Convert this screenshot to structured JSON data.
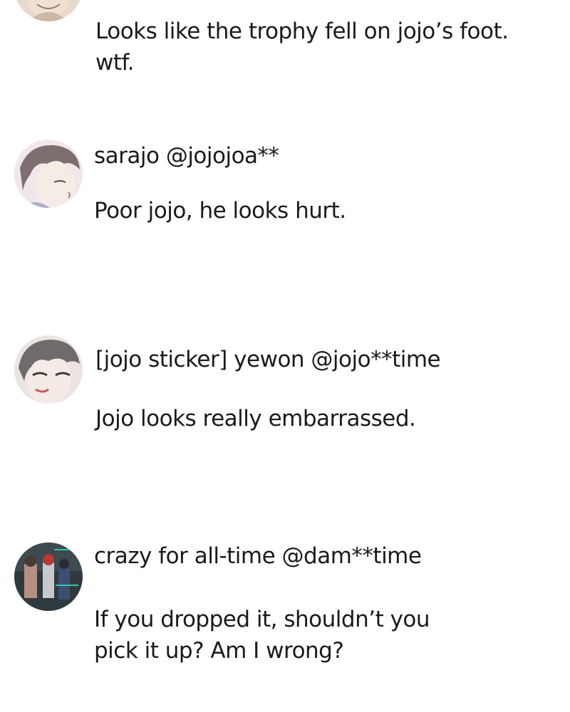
{
  "comments": [
    {
      "username": "",
      "body": "Looks like the trophy fell on jojo’s foot.\nwtf.",
      "avatar_icon": "avatar-face-partial"
    },
    {
      "username": "sarajo @jojojoa**",
      "body": "Poor jojo, he looks hurt.",
      "avatar_icon": "avatar-boy-gray-hair"
    },
    {
      "username": "[jojo sticker]  yewon @jojo**time",
      "body": "Jojo looks really embarrassed.",
      "avatar_icon": "avatar-boy-closeup"
    },
    {
      "username": "crazy for all-time @dam**time",
      "body": "If you dropped it, shouldn’t you\npick it up?  Am I wrong?",
      "avatar_icon": "avatar-group-scene"
    }
  ]
}
